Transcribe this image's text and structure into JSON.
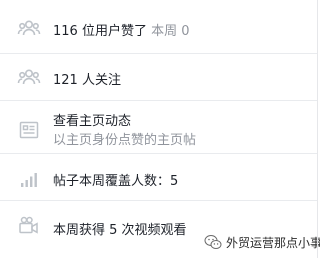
{
  "stats": {
    "likes": {
      "count_text": "116 位用户赞了",
      "week_text": "本周 0",
      "icon": "people-icon"
    },
    "followers": {
      "text": "121 人关注",
      "icon": "people-icon"
    },
    "page_activity": {
      "title": "查看主页动态",
      "subtitle": "以主页身份点赞的主页帖",
      "icon": "news-feed-icon"
    },
    "reach": {
      "text": "帖子本周覆盖人数：5",
      "icon": "signal-bars-icon"
    },
    "video": {
      "text": "本周获得 5 次视频观看",
      "icon": "video-camera-icon"
    }
  },
  "watermark": {
    "text": "外贸运营那点小事",
    "icon": "wechat-logo-icon"
  },
  "colors": {
    "text": "#1d2129",
    "muted": "#90949c",
    "icon": "#bec3c9",
    "divider": "#e9ebee"
  }
}
